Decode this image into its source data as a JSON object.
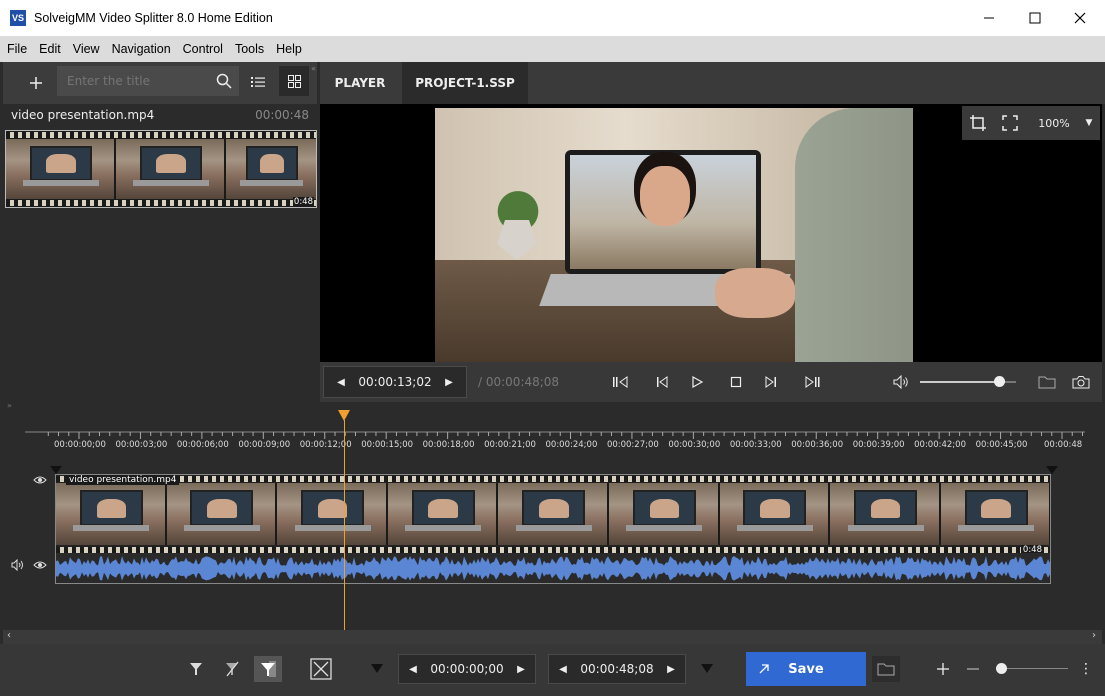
{
  "window": {
    "app_icon": "VS",
    "title": "SolveigMM Video Splitter 8.0 Home Edition",
    "controls": [
      "minimize-icon",
      "maximize-icon",
      "close-icon"
    ]
  },
  "menu": [
    "File",
    "Edit",
    "View",
    "Navigation",
    "Control",
    "Tools",
    "Help"
  ],
  "library": {
    "add_icon": "plus-icon",
    "search_placeholder": "Enter the title",
    "search_icon": "search-icon",
    "list_view_icon": "list-icon",
    "grid_view_icon": "grid-icon",
    "file_name": "video presentation.mp4",
    "file_duration": "00:00:48",
    "thumb_badge": "0:48"
  },
  "tabs": [
    "PLAYER",
    "PROJECT-1.SSP"
  ],
  "player": {
    "crop_icon": "crop-icon",
    "fullscreen_icon": "fullscreen-icon",
    "zoom": "100%",
    "current_time": "00:00:13;02",
    "total_time": "/ 00:00:48;08",
    "volume_level": 0.82
  },
  "timeline": {
    "ticks": [
      "00:00:00;00",
      "00:00:03;00",
      "00:00:06;00",
      "00:00:09;00",
      "00:00:12;00",
      "00:00:15;00",
      "00:00:18;00",
      "00:00:21;00",
      "00:00:24;00",
      "00:00:27;00",
      "00:00:30;00",
      "00:00:33;00",
      "00:00:36;00",
      "00:00:39;00",
      "00:00:42;00",
      "00:00:45;00",
      "00:00:48"
    ],
    "clip_name": "video presentation.mp4",
    "clip_end_badge": "0:48",
    "playhead_fraction": 0.27
  },
  "bottom": {
    "start_time": "00:00:00;00",
    "end_time": "00:00:48;08",
    "save_label": "Save"
  },
  "colors": {
    "accent": "#2f69d1",
    "playhead": "#f0a030",
    "waveform": "#5b86d4"
  }
}
